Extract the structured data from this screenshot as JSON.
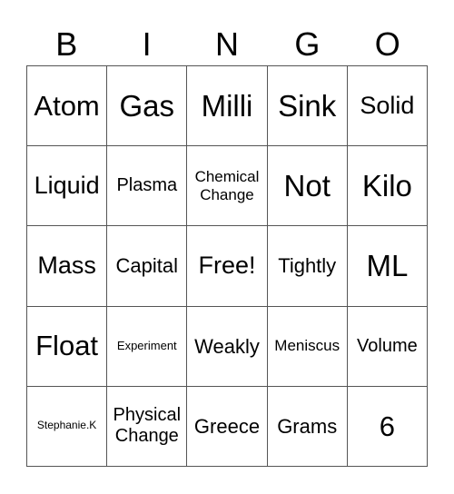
{
  "header": {
    "letters": [
      "B",
      "I",
      "N",
      "G",
      "O"
    ]
  },
  "cells": [
    [
      "Atom",
      "Gas",
      "Milli",
      "Sink",
      "Solid"
    ],
    [
      "Liquid",
      "Plasma",
      "Chemical Change",
      "Not",
      "Kilo"
    ],
    [
      "Mass",
      "Capital",
      "Free!",
      "Tightly",
      "ML"
    ],
    [
      "Float",
      "Experiment",
      "Weakly",
      "Meniscus",
      "Volume"
    ],
    [
      "Stephanie.K",
      "Physical Change",
      "Greece",
      "Grams",
      "6"
    ]
  ]
}
